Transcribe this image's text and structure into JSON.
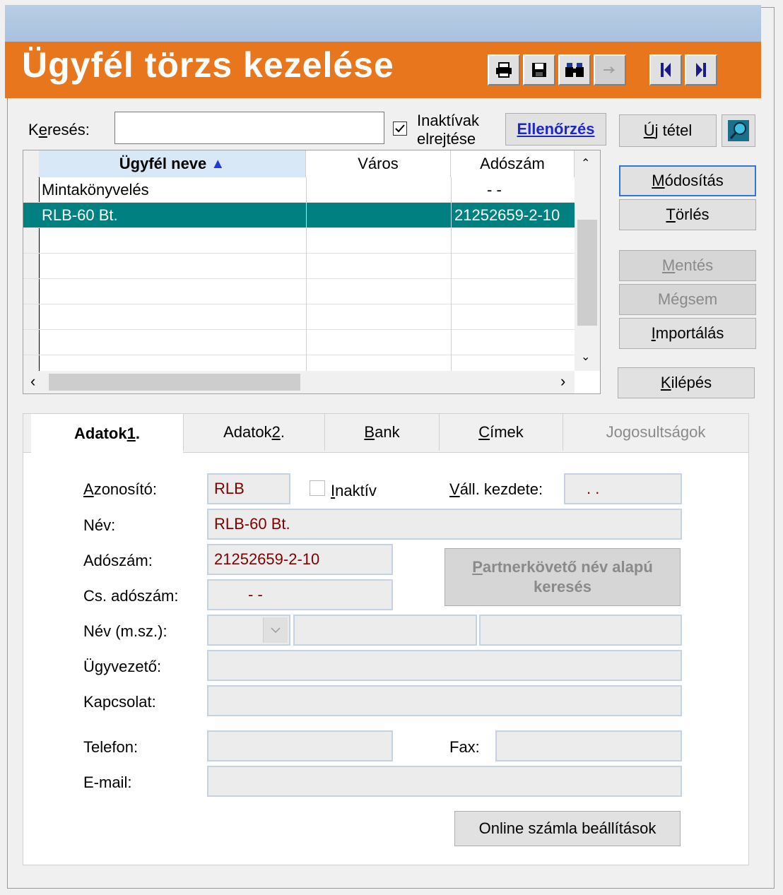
{
  "header": {
    "title": "Ügyfél törzs kezelése"
  },
  "toolbar": {
    "icons": [
      "printer-icon",
      "save-icon",
      "binoculars-icon",
      "disabled-icon",
      "first-record-icon",
      "last-record-icon"
    ]
  },
  "search": {
    "label_pre": "K",
    "label_underline": "e",
    "label_post": "resés:",
    "value": ""
  },
  "hide_inactive": {
    "line1": "Inaktívak",
    "line2": "elrejtése",
    "checked": true
  },
  "buttons": {
    "ellenorzes": "Ellenőrzés",
    "uj_tetel_u": "Ú",
    "uj_tetel_rest": "j tétel",
    "modositas_u": "M",
    "modositas_rest": "ódosítás",
    "torles_u": "T",
    "torles_rest": "örlés",
    "mentes_u": "M",
    "mentes_rest": "entés",
    "megsem_pre": "Mé",
    "megsem_u": "g",
    "megsem_rest": "sem",
    "importalas_u": "I",
    "importalas_rest": "mportálás",
    "kilepes_u": "K",
    "kilepes_rest": "ilépés",
    "partner_line1_u": "P",
    "partner_line1_rest": "artnerkövető név alapú",
    "partner_line2": "keresés",
    "online": "Online számla beállítások"
  },
  "grid": {
    "columns": [
      "Ügyfél neve",
      "Város",
      "Adószám"
    ],
    "sort_arrow": "▲",
    "rows": [
      {
        "name": "Mintakönyvelés",
        "city": "",
        "tax": "- -"
      },
      {
        "name": "RLB-60 Bt.",
        "city": "",
        "tax": "21252659-2-10"
      }
    ]
  },
  "tabs": {
    "adatok1_pre": "Adatok ",
    "adatok1_u": "1",
    "adatok1_post": ".",
    "adatok2_pre": "Adatok ",
    "adatok2_u": "2",
    "adatok2_post": ".",
    "bank_u": "B",
    "bank_rest": "ank",
    "cimek_u": "C",
    "cimek_rest": "ímek",
    "jogosultsagok": "Jogosultságok"
  },
  "form": {
    "azonosito_label_u": "A",
    "azonosito_label_rest": "zonosító:",
    "azonosito_value": "RLB",
    "inaktiv_u": "I",
    "inaktiv_rest": "naktív",
    "vall_u": "V",
    "vall_rest": "áll. kezdete:",
    "vall_value": ". .",
    "nev_label": "Név:",
    "nev_value": "RLB-60 Bt.",
    "adoszam_label": "Adószám:",
    "adoszam_value": "21252659-2-10",
    "cs_adoszam_label": "Cs. adószám:",
    "cs_adoszam_value": "- -",
    "nev_msz_label": "Név (m.sz.):",
    "ugyvezeto_label": "Ügyvezető:",
    "kapcsolat_label": "Kapcsolat:",
    "telefon_label": "Telefon:",
    "fax_label": "Fax:",
    "email_label": "E-mail:"
  },
  "colors": {
    "header_orange": "#e8761c",
    "selected_row": "#008080",
    "field_value": "#800000"
  }
}
